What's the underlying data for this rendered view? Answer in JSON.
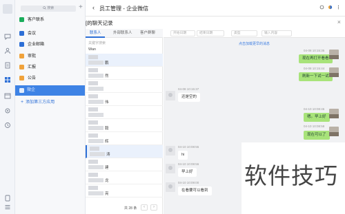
{
  "directory": {
    "search_placeholder": "搜索",
    "items": [
      {
        "label": "客户联系",
        "color": "#1aad5b"
      },
      {
        "label": "会议",
        "color": "#2d6fd6"
      },
      {
        "label": "企业邮箱",
        "color": "#2d6fd6"
      },
      {
        "label": "审批",
        "color": "#f0a23b"
      },
      {
        "label": "汇报",
        "color": "#f0a23b"
      },
      {
        "label": "公告",
        "color": "#f0a23b"
      }
    ],
    "selected_item": "微企",
    "add_app": "添加第三方应用"
  },
  "window": {
    "back_icon": "chevron-left-icon",
    "title": "员工管理 - 企业微信",
    "subtitle": "的聊天记录"
  },
  "employee_panel": {
    "tabs": [
      "联系人",
      "外部联系人",
      "客户群聊"
    ],
    "active_tab": "联系人",
    "search_placeholder": "关键字搜索",
    "group_label": "Wan",
    "rows": [
      {
        "name": "鹏"
      },
      {
        "name": "然"
      },
      {
        "name": ""
      },
      {
        "name": "伟"
      },
      {
        "name": ""
      },
      {
        "name": "毅"
      },
      {
        "name": "辉"
      },
      {
        "name": "涛"
      },
      {
        "name": "建"
      },
      {
        "name": "龙"
      },
      {
        "name": "亮"
      }
    ],
    "pager": {
      "count": "共 28 条"
    }
  },
  "chat": {
    "filters": {
      "start_date": "开始日期",
      "end_date": "结束日期",
      "type": "类型",
      "keyword": "输入内容"
    },
    "load_more": "点击加载更早的消息",
    "messages": [
      {
        "side": "right",
        "time": "04-08 10:15:35",
        "text": "现在再打开看看"
      },
      {
        "side": "right",
        "time": "04-08 10:15:44",
        "text": "刷新一下试一试"
      },
      {
        "side": "left",
        "time": "04-08 10:15:37",
        "text": "还是空的"
      },
      {
        "side": "right",
        "time": "04-10 10:08:46",
        "text": "嗯。早上好"
      },
      {
        "side": "right",
        "time": "04-10 10:08:58",
        "text": "现在可以了"
      },
      {
        "side": "left",
        "time": "04-10 10:08:55",
        "text": "hi"
      },
      {
        "side": "left",
        "time": "04-10 10:08:56",
        "text": "早上好"
      },
      {
        "side": "left",
        "time": "04-10 10:09:00",
        "text": "在看要可以看到"
      }
    ]
  },
  "watermark": "软件技巧"
}
